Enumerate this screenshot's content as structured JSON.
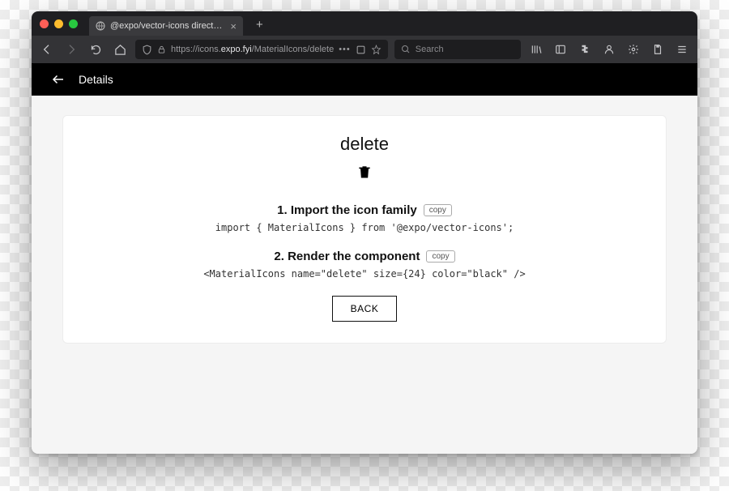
{
  "browser": {
    "tab_title": "@expo/vector-icons directory",
    "url_prefix": "https://icons.",
    "url_host": "expo.fyi",
    "url_path": "/MaterialIcons/delete",
    "search_placeholder": "Search"
  },
  "header": {
    "title": "Details"
  },
  "card": {
    "icon_name": "delete",
    "step1_title": "1. Import the icon family",
    "step1_copy": "copy",
    "step1_code": "import { MaterialIcons } from '@expo/vector-icons';",
    "step2_title": "2. Render the component",
    "step2_copy": "copy",
    "step2_code": "<MaterialIcons name=\"delete\" size={24} color=\"black\" />",
    "back_button": "BACK"
  }
}
